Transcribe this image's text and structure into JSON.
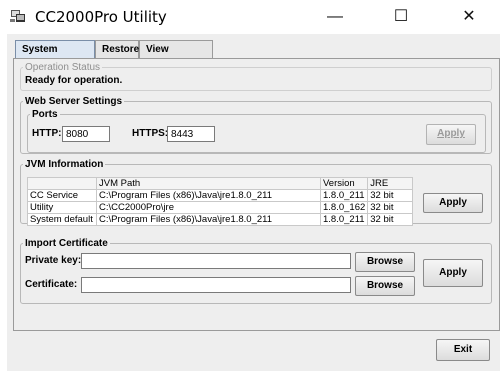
{
  "window": {
    "title": "CC2000Pro Utility",
    "minimize": "—",
    "maximize": "☐",
    "close": "✕"
  },
  "tabs": [
    {
      "label": "System Settings",
      "active": true
    },
    {
      "label": "Restore",
      "active": false
    },
    {
      "label": "View Licenses",
      "active": false
    }
  ],
  "operation_status": {
    "legend": "Operation Status",
    "text": "Ready for operation."
  },
  "web_server": {
    "legend": "Web Server Settings",
    "ports_legend": "Ports",
    "http_label": "HTTP:",
    "http_value": "8080",
    "https_label": "HTTPS:",
    "https_value": "8443",
    "apply_label": "Apply"
  },
  "jvm": {
    "legend": "JVM Information",
    "columns": [
      "",
      "JVM Path",
      "Version",
      "JRE"
    ],
    "rows": [
      [
        "CC Service",
        "C:\\Program Files (x86)\\Java\\jre1.8.0_211",
        "1.8.0_211",
        "32 bit"
      ],
      [
        "Utility",
        "C:\\CC2000Pro\\jre",
        "1.8.0_162",
        "32 bit"
      ],
      [
        "System default",
        "C:\\Program Files (x86)\\Java\\jre1.8.0_211",
        "1.8.0_211",
        "32 bit"
      ]
    ],
    "apply_label": "Apply"
  },
  "import_certificate": {
    "legend": "Import Certificate",
    "private_key_label": "Private key:",
    "private_key_value": "",
    "certificate_label": "Certificate:",
    "certificate_value": "",
    "browse_label": "Browse",
    "apply_label": "Apply"
  },
  "footer": {
    "exit_label": "Exit"
  },
  "colors": {
    "active_tab": "#dde7f3",
    "background": "#eeeeee"
  }
}
